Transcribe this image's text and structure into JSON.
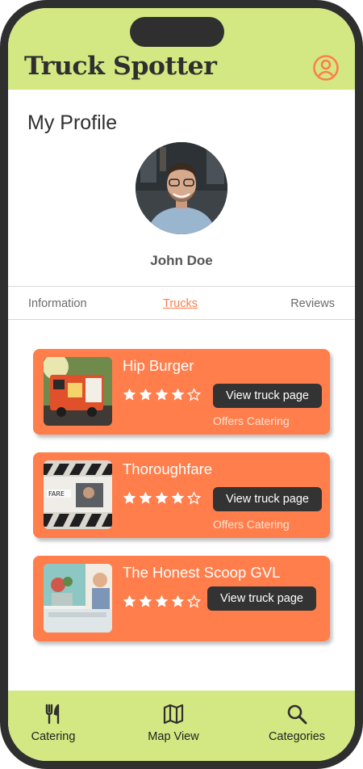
{
  "app": {
    "brand": "Truck Spotter"
  },
  "page": {
    "title": "My Profile"
  },
  "user": {
    "name": "John Doe"
  },
  "tabs": [
    {
      "label": "Information"
    },
    {
      "label": "Trucks",
      "active": true
    },
    {
      "label": "Reviews"
    }
  ],
  "trucks": [
    {
      "name": "Hip Burger",
      "rating": 4,
      "max_rating": 5,
      "button": "View truck page",
      "tag": "Offers Catering"
    },
    {
      "name": "Thoroughfare",
      "rating": 4,
      "max_rating": 5,
      "button": "View truck page",
      "tag": "Offers Catering"
    },
    {
      "name": "The Honest Scoop GVL",
      "rating": 4,
      "max_rating": 5,
      "button": "View truck page"
    }
  ],
  "bottom_nav": [
    {
      "label": "Catering",
      "icon": "fork-knife-icon"
    },
    {
      "label": "Map View",
      "icon": "map-icon"
    },
    {
      "label": "Categories",
      "icon": "search-icon"
    }
  ],
  "colors": {
    "header_bg": "#d3e882",
    "accent": "#ff7e4b",
    "dark": "#333333"
  }
}
